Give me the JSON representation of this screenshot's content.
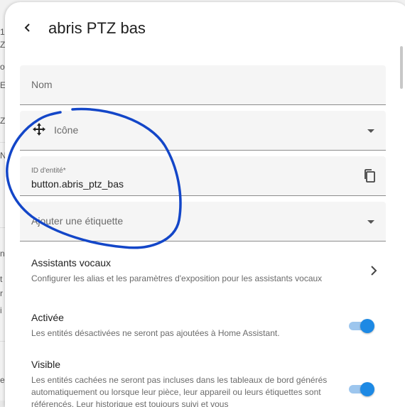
{
  "backdrop": {
    "fragments": [
      "1",
      "Z",
      "o",
      "E",
      "Z",
      "N",
      "n",
      "t",
      "r",
      "i",
      "e"
    ]
  },
  "header": {
    "title": "abris PTZ bas"
  },
  "form": {
    "name_label": "Nom",
    "icon_label": "Icône",
    "entity_id_label": "ID d'entité*",
    "entity_id_value": "button.abris_ptz_bas",
    "tag_label": "Ajouter une étiquette"
  },
  "voice": {
    "title": "Assistants vocaux",
    "description": "Configurer les alias et les paramètres d'exposition pour les assistants vocaux"
  },
  "enabled": {
    "title": "Activée",
    "description": "Les entités désactivées ne seront pas ajoutées à Home Assistant.",
    "on": true
  },
  "visible": {
    "title": "Visible",
    "description": "Les entités cachées ne seront pas incluses dans les tableaux de bord générés automatiquement ou lorsque leur pièce, leur appareil ou leurs étiquettes sont référencés. Leur historique est toujours suivi et vous",
    "on": true
  },
  "colors": {
    "accent": "#1d89e4",
    "annotation": "#1346c8"
  }
}
